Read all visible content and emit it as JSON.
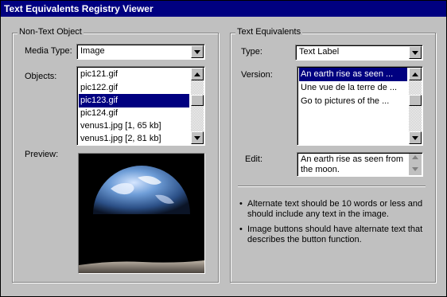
{
  "window": {
    "title": "Text Equivalents Registry Viewer"
  },
  "non_text": {
    "title": "Non-Text Object",
    "media_type_label": "Media Type:",
    "media_type_value": "Image",
    "objects_label": "Objects:",
    "objects": [
      "pic121.gif",
      "pic122.gif",
      "pic123.gif",
      "pic124.gif",
      "venus1.jpg [1, 65 kb]",
      "venus1.jpg [2, 81 kb]"
    ],
    "selected_object": "pic123.gif",
    "preview_label": "Preview:"
  },
  "text_eq": {
    "title": "Text Equivalents",
    "type_label": "Type:",
    "type_value": "Text Label",
    "version_label": "Version:",
    "versions": [
      "An earth rise as seen ...",
      "Une vue de la terre de ...",
      "Go to pictures of the ..."
    ],
    "selected_version": "An earth rise as seen ...",
    "edit_label": "Edit:",
    "edit_value": "An earth rise as seen from the moon.",
    "notes": [
      "Alternate text should be 10 words or less and should include any text in the image.",
      "Image buttons should have alternate text that describes the button function."
    ]
  },
  "colors": {
    "titlebar": "#000080",
    "face": "#c0c0c0",
    "selection": "#000080"
  }
}
